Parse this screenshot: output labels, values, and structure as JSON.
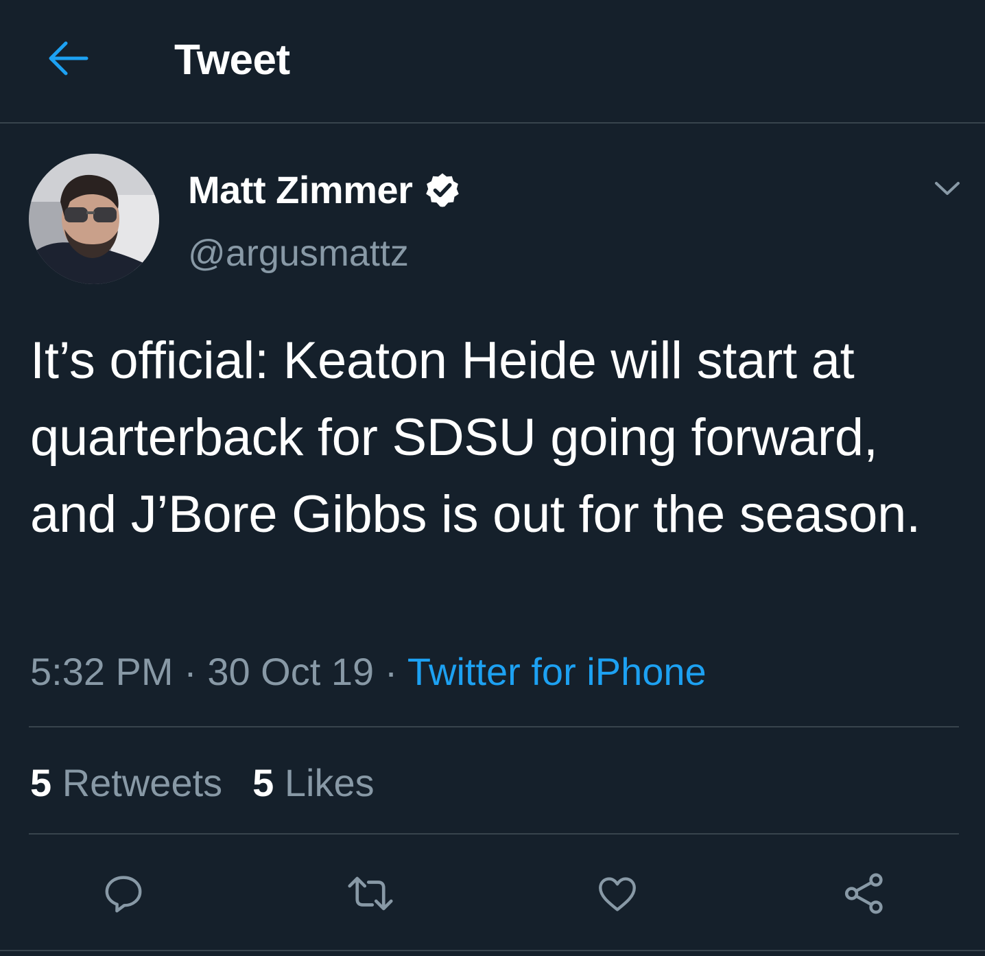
{
  "header": {
    "title": "Tweet",
    "back_icon": "arrow-left-icon"
  },
  "author": {
    "name": "Matt Zimmer",
    "handle": "@argusmattz",
    "verified": true
  },
  "tweet": {
    "text": "It’s official: Keaton Heide will start at quarterback for SDSU going forward, and J’Bore Gibbs is out for the season.",
    "time": "5:32 PM",
    "date": "30 Oct 19",
    "separator": " · ",
    "source": "Twitter for iPhone"
  },
  "stats": {
    "retweets_count": "5",
    "retweets_label": "Retweets",
    "likes_count": "5",
    "likes_label": "Likes"
  },
  "actions": [
    "reply-icon",
    "retweet-icon",
    "like-icon",
    "share-icon"
  ],
  "colors": {
    "background": "#15202b",
    "accent": "#1da1f2",
    "secondary_text": "#8899a6",
    "divider": "#38444d"
  }
}
